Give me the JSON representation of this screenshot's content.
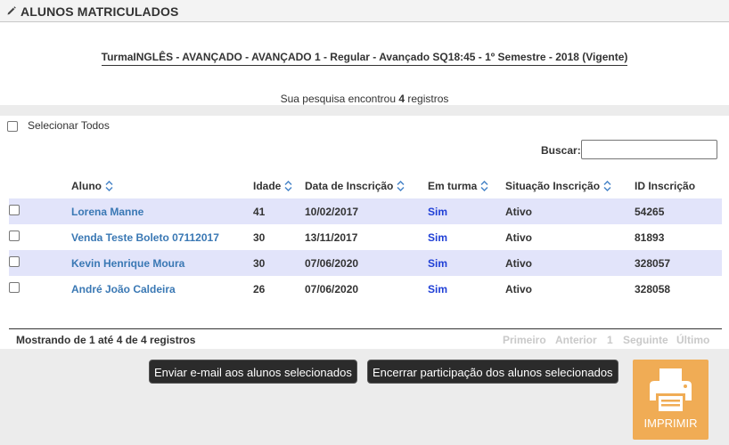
{
  "header": {
    "title": "ALUNOS MATRICULADOS",
    "icon": "pencil-icon"
  },
  "turma": "TurmaINGLÊS - AVANÇADO - AVANÇADO 1 - Regular - Avançado SQ18:45 - 1º Semestre - 2018 (Vigente)",
  "search_result": {
    "prefix": "Sua pesquisa encontrou ",
    "count": "4",
    "suffix": " registros"
  },
  "select_all_label": "Selecionar Todos",
  "search": {
    "label": "Buscar:",
    "value": ""
  },
  "table": {
    "columns": [
      "Aluno",
      "Idade",
      "Data de Inscrição",
      "Em turma",
      "Situação Inscrição",
      "ID Inscrição"
    ],
    "rows": [
      {
        "aluno": "Lorena Manne",
        "idade": "41",
        "data": "10/02/2017",
        "em_turma": "Sim",
        "situacao": "Ativo",
        "id": "54265"
      },
      {
        "aluno": "Venda Teste Boleto 07112017",
        "idade": "30",
        "data": "13/11/2017",
        "em_turma": "Sim",
        "situacao": "Ativo",
        "id": "81893"
      },
      {
        "aluno": "Kevin Henrique Moura",
        "idade": "30",
        "data": "07/06/2020",
        "em_turma": "Sim",
        "situacao": "Ativo",
        "id": "328057"
      },
      {
        "aluno": "André João Caldeira",
        "idade": "26",
        "data": "07/06/2020",
        "em_turma": "Sim",
        "situacao": "Ativo",
        "id": "328058"
      }
    ]
  },
  "footer": {
    "showing": "Mostrando de 1 até 4 de 4 registros",
    "pager": {
      "first": "Primeiro",
      "previous": "Anterior",
      "page": "1",
      "next": "Seguinte",
      "last": "Último"
    }
  },
  "actions": {
    "email": "Enviar e-mail aos alunos selecionados",
    "end": "Encerrar participação dos alunos selecionados",
    "print": "IMPRIMIR"
  },
  "colors": {
    "link": "#3a78b4",
    "sim": "#1f3fd6",
    "row_stripe": "#e2e4fa",
    "print": "#f0ac55"
  }
}
